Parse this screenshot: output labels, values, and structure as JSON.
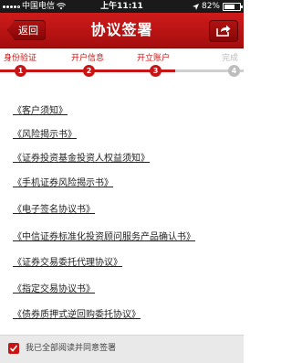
{
  "status_bar": {
    "carrier": "中国电信",
    "time": "上午11:11",
    "battery": "82%",
    "battery_level": 0.82
  },
  "nav": {
    "back_label": "返回",
    "title": "协议签署",
    "share_icon": "share-icon"
  },
  "stepper": {
    "steps": [
      {
        "label": "身份验证",
        "number": "1",
        "state": "done"
      },
      {
        "label": "开户信息",
        "number": "2",
        "state": "done"
      },
      {
        "label": "开立账户",
        "number": "3",
        "state": "current"
      },
      {
        "label": "完成",
        "number": "4",
        "state": "future"
      }
    ],
    "progress": 0.72,
    "active_color": "#c81414",
    "inactive_color": "#bdbdbd"
  },
  "documents": [
    "《客户须知》",
    "《风险揭示书》",
    "《证券投资基金投资人权益须知》",
    "《手机证券风险揭示书》",
    "《电子签名协议书》",
    "《中信证券标准化投资顾问服务产品确认书》",
    "《证券交易委托代理协议》",
    "《指定交易协议书》",
    "《债券质押式逆回购委托协议》"
  ],
  "footer": {
    "agree_label": "我已全部阅读并同意签署",
    "checked": true
  }
}
